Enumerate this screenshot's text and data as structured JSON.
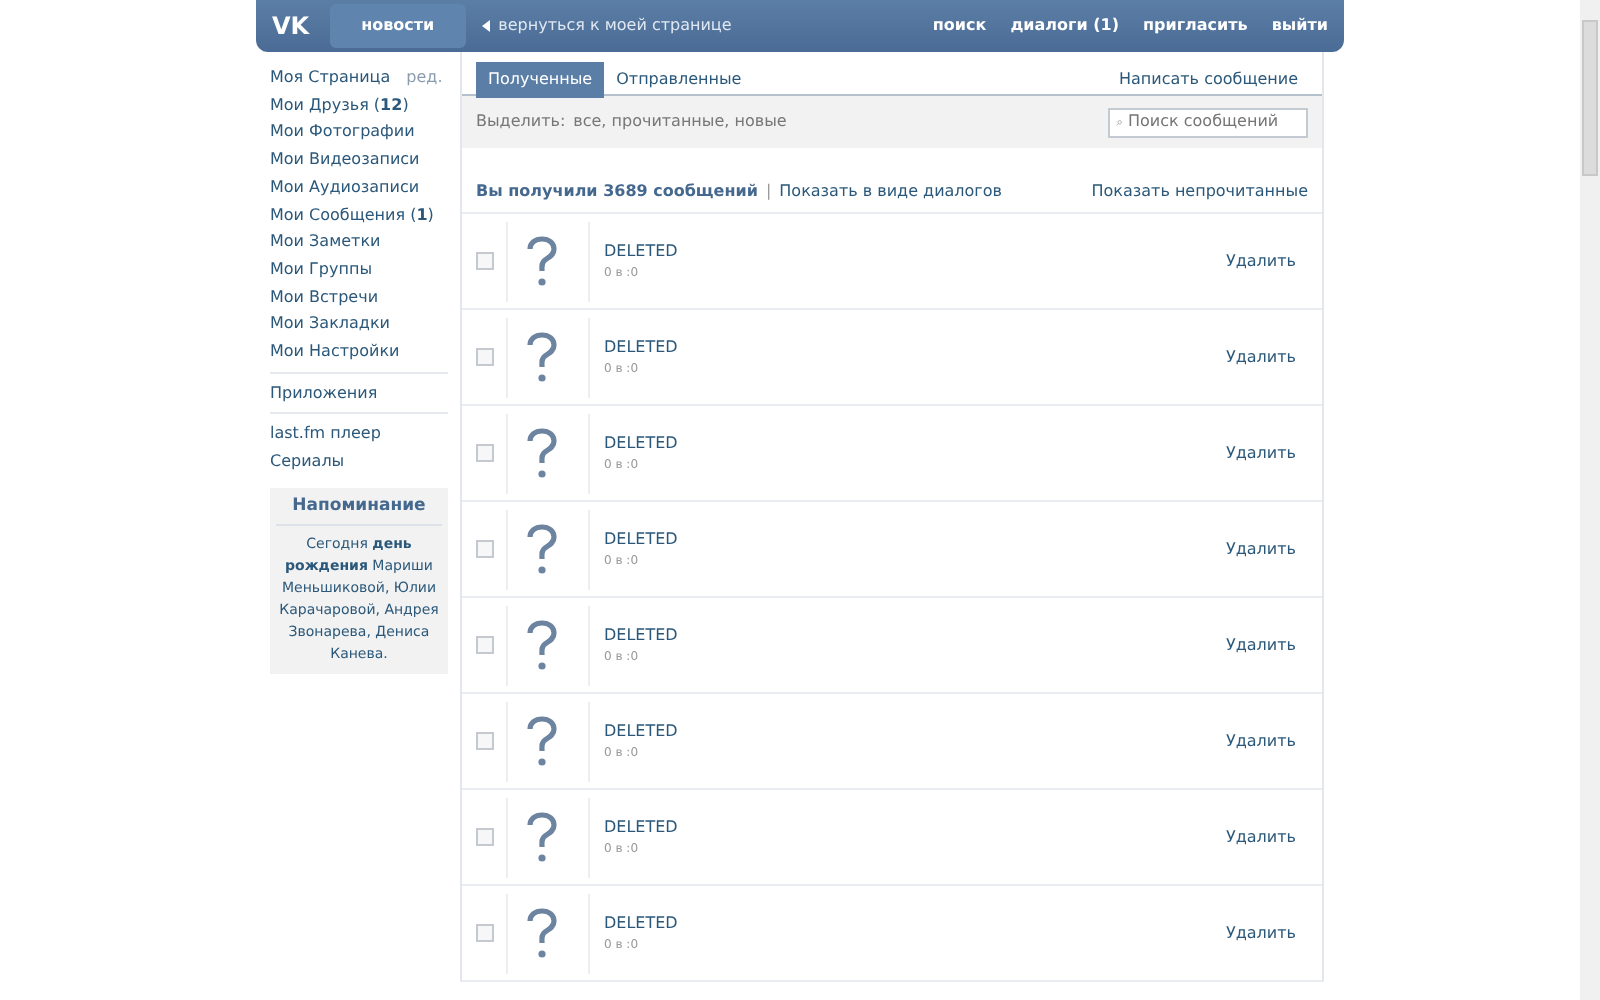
{
  "header": {
    "logo": "VK",
    "news_tab": "новости",
    "back_link": "вернуться к моей странице",
    "links": [
      "поиск",
      "диалоги (1)",
      "пригласить",
      "выйти"
    ]
  },
  "sidebar": {
    "edit_link": "ред.",
    "groups": [
      {
        "items": [
          "Моя Страница",
          "Мои Друзья (**12**)",
          "Мои Фотографии",
          "Мои Видеозаписи",
          "Мои Аудиозаписи",
          "Мои Сообщения (**1**)",
          "Мои Заметки",
          "Мои Группы",
          "Мои Встречи",
          "Мои Закладки",
          "Мои Настройки"
        ]
      },
      {
        "items": [
          "Приложения"
        ]
      },
      {
        "items": [
          "last.fm плеер",
          "Сериалы"
        ]
      }
    ],
    "reminder": {
      "title": "Напоминание",
      "text": "Сегодня **день рождения** Мариши Меньшиковой, Юлии Карачаровой, Андрея Звонарева, Дениса Канева."
    }
  },
  "tabs": [
    {
      "label": "Полученные",
      "selected": true
    },
    {
      "label": "Отправленные",
      "selected": false
    }
  ],
  "compose_link": "Написать сообщение",
  "filter": {
    "label": "Выделить:",
    "options": "все, прочитанные, новые"
  },
  "search": {
    "placeholder": "Поиск сообщений"
  },
  "summary": {
    "count": "Вы получили 3689 сообщений",
    "separator": "|",
    "dialog_link": "Показать в виде диалогов",
    "unread_link": "Показать непрочитанные"
  },
  "messages": [
    {
      "name": "DELETED",
      "date": "0 в :0",
      "delete": "Удалить",
      "checked": false
    },
    {
      "name": "DELETED",
      "date": "0 в :0",
      "delete": "Удалить",
      "checked": false
    },
    {
      "name": "DELETED",
      "date": "0 в :0",
      "delete": "Удалить",
      "checked": false
    },
    {
      "name": "DELETED",
      "date": "0 в :0",
      "delete": "Удалить",
      "checked": false
    },
    {
      "name": "DELETED",
      "date": "0 в :0",
      "delete": "Удалить",
      "checked": false
    },
    {
      "name": "DELETED",
      "date": "0 в :0",
      "delete": "Удалить",
      "checked": false
    },
    {
      "name": "DELETED",
      "date": "0 в :0",
      "delete": "Удалить",
      "checked": false
    },
    {
      "name": "DELETED",
      "date": "0 в :0",
      "delete": "Удалить",
      "checked": false
    }
  ]
}
